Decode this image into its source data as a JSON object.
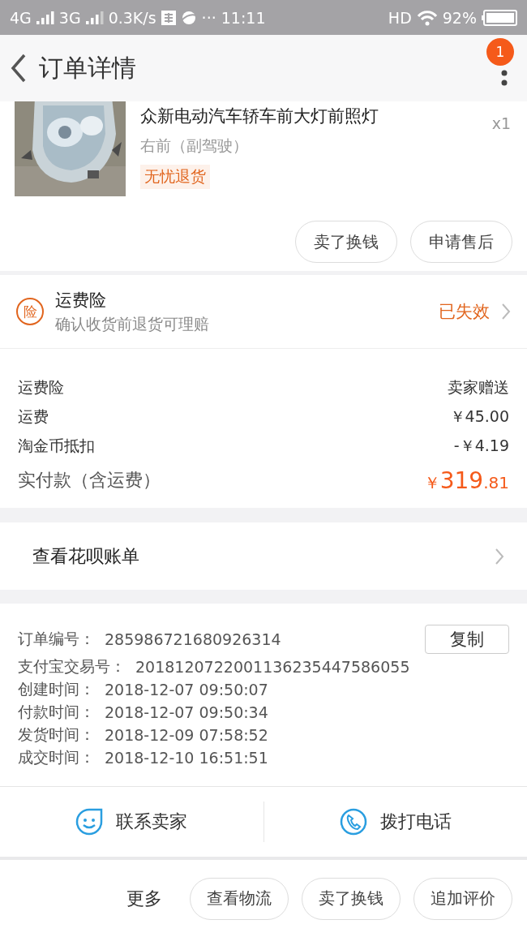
{
  "status_bar": {
    "network_1": "4G",
    "network_2": "3G",
    "speed": "0.3K/s",
    "more": "···",
    "time": "11:11",
    "hd": "HD",
    "battery": "92%"
  },
  "nav": {
    "title": "订单详情",
    "badge": "1"
  },
  "product": {
    "name": "众新电动汽车轿车前大灯前照灯",
    "variant": "右前（副驾驶）",
    "tag": "无忧退货",
    "quantity": "x1",
    "actions": [
      "卖了换钱",
      "申请售后"
    ]
  },
  "insurance": {
    "badge": "险",
    "title": "运费险",
    "subtitle": "确认收货前退货可理赔",
    "status": "已失效"
  },
  "fees": [
    {
      "label": "运费险",
      "value": "卖家赠送"
    },
    {
      "label": "运费",
      "value": "￥45.00"
    },
    {
      "label": "淘金币抵扣",
      "value": "-￥4.19"
    }
  ],
  "total": {
    "label": "实付款（含运费）",
    "currency": "￥",
    "integer": "319",
    "decimal": ".81"
  },
  "huabei": {
    "label": "查看花呗账单"
  },
  "order_info": {
    "copy_button": "复制",
    "rows": [
      {
        "label": "订单编号：",
        "value": "285986721680926314"
      },
      {
        "label": "支付宝交易号：",
        "value": "2018120722001136235447586055"
      },
      {
        "label": "创建时间：",
        "value": "2018-12-07 09:50:07"
      },
      {
        "label": "付款时间：",
        "value": "2018-12-07 09:50:34"
      },
      {
        "label": "发货时间：",
        "value": "2018-12-09 07:58:52"
      },
      {
        "label": "成交时间：",
        "value": "2018-12-10 16:51:51"
      }
    ]
  },
  "contact": [
    {
      "kind": "chat",
      "label": "联系卖家"
    },
    {
      "kind": "phone",
      "label": "拨打电话"
    }
  ],
  "bottom": {
    "more": "更多",
    "actions": [
      "查看物流",
      "卖了换钱",
      "追加评价"
    ]
  }
}
